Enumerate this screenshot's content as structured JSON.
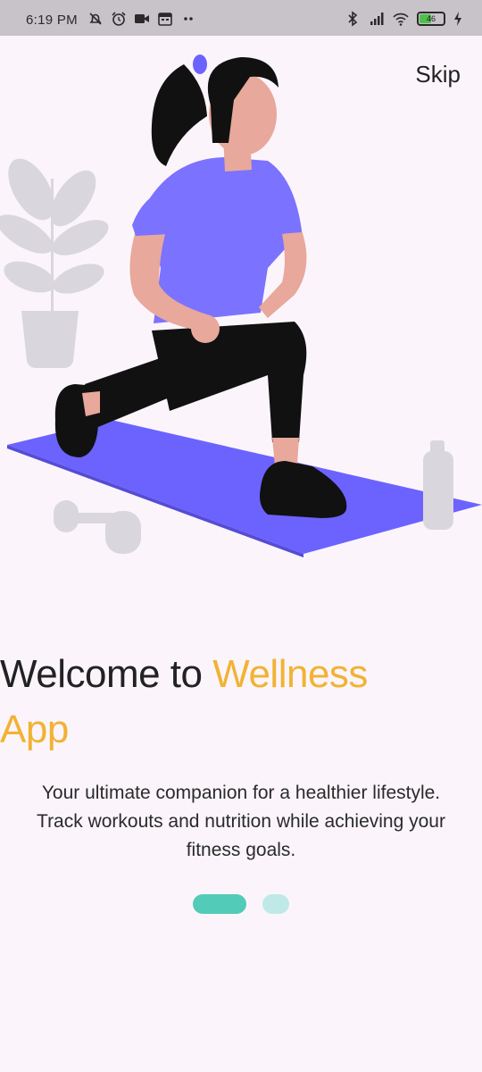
{
  "status_bar": {
    "time": "6:19 PM",
    "battery_level": "46",
    "icons_left": [
      "notifications-off-icon",
      "alarm-icon",
      "video-icon",
      "calendar-icon",
      "more-dots-icon"
    ],
    "icons_right": [
      "bluetooth-icon",
      "signal-icon",
      "wifi-icon",
      "battery-icon",
      "charging-icon"
    ]
  },
  "onboarding": {
    "skip_label": "Skip",
    "title_prefix": "Welcome to ",
    "title_accent": "Wellness",
    "title_suffix": "App",
    "subtitle": "Your ultimate companion for a healthier lifestyle. Track workouts and nutrition while achieving your fitness goals.",
    "page_index": 1,
    "page_count": 2
  },
  "colors": {
    "background": "#fbf5fb",
    "accent": "#f2b233",
    "dot_active": "#52cbb8",
    "dot_inactive": "#bfe9e7",
    "mat": "#6c63ff",
    "shirt": "#7b72ff"
  }
}
